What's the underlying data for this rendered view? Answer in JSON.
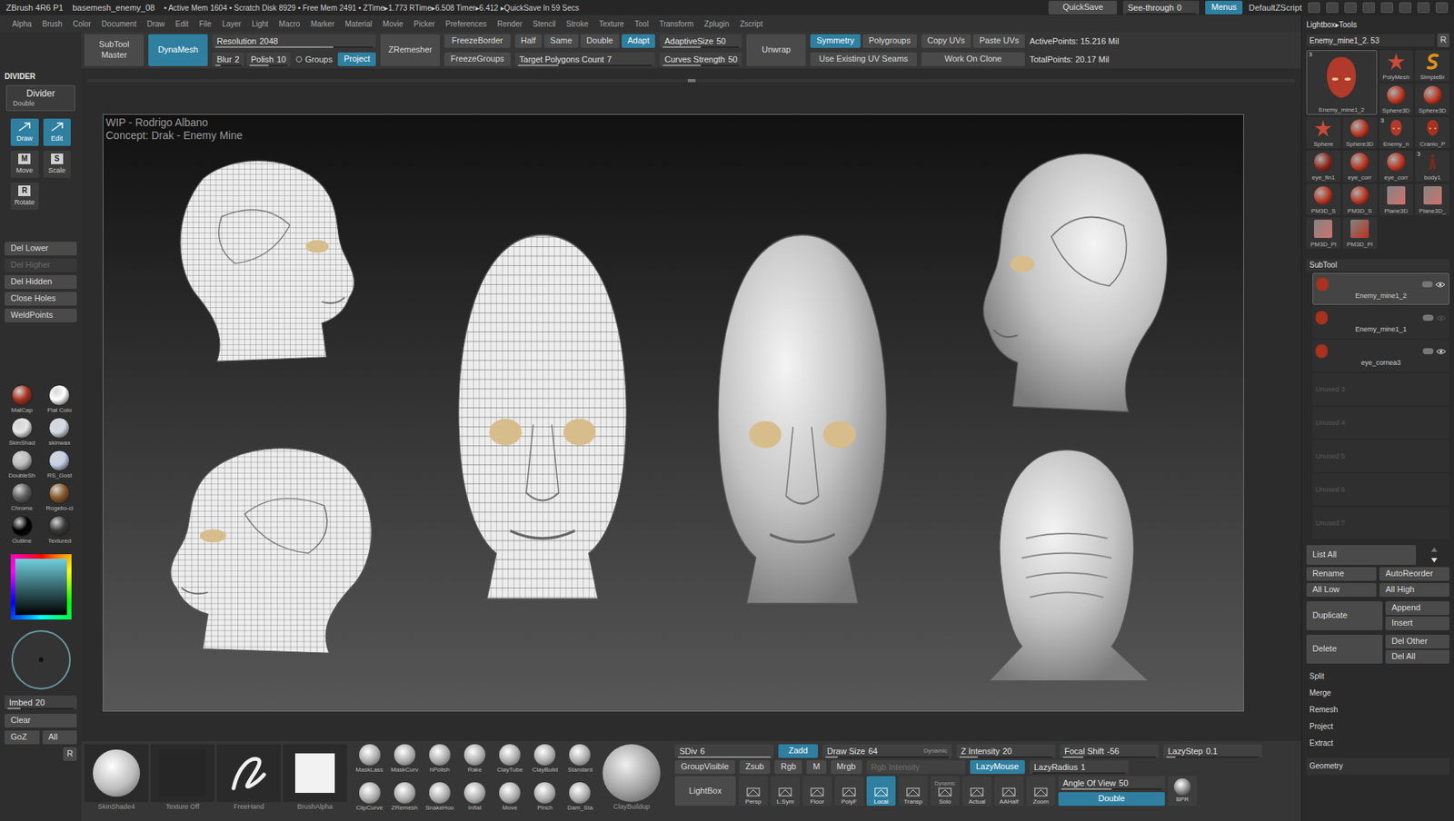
{
  "title_bar": {
    "app": "ZBrush 4R6 P1",
    "file": "basemesh_enemy_08",
    "stats": "• Active Mem 1604 • Scratch Disk 8929 • Free Mem 2491 • ZTime▸1.773 RTime▸6.508 Timer▸6.412 ▸QuickSave In 59 Secs",
    "quicksave": "QuickSave",
    "see_through": {
      "label": "See-through",
      "value": "0",
      "level": 0
    },
    "menus": {
      "label": "Menus",
      "selected": true
    },
    "script": "DefaultZScript"
  },
  "menu": [
    "Alpha",
    "Brush",
    "Color",
    "Document",
    "Draw",
    "Edit",
    "File",
    "Layer",
    "Light",
    "Macro",
    "Marker",
    "Material",
    "Movie",
    "Picker",
    "Preferences",
    "Render",
    "Stencil",
    "Stroke",
    "Texture",
    "Tool",
    "Transform",
    "Zplugin",
    "Zscript"
  ],
  "top_shelf": [
    {
      "kind": "big",
      "label": "SubTool Master",
      "active": false
    },
    {
      "kind": "big",
      "label": "DynaMesh",
      "active": true
    },
    {
      "kind": "stack",
      "rows": [
        [
          {
            "kind": "slider",
            "label": "Resolution",
            "value": "2048",
            "level": 0.75
          }
        ],
        [
          {
            "kind": "slider",
            "label": "Blur",
            "value": "2",
            "level": 0.2
          },
          {
            "kind": "slider",
            "label": "Polish",
            "value": "10",
            "level": 0.5
          },
          {
            "kind": "toggle",
            "label": "Groups",
            "active": false
          },
          {
            "kind": "button",
            "label": "Project",
            "active": true
          }
        ]
      ]
    },
    {
      "kind": "big",
      "label": "ZRemesher",
      "active": false
    },
    {
      "kind": "stack",
      "rows": [
        [
          {
            "kind": "button",
            "label": "FreezeBorder",
            "active": false
          }
        ],
        [
          {
            "kind": "button",
            "label": "FreezeGroups",
            "active": false
          }
        ]
      ]
    },
    {
      "kind": "stack",
      "rows": [
        [
          {
            "kind": "button",
            "label": "Half",
            "active": false
          },
          {
            "kind": "button",
            "label": "Same",
            "active": false
          },
          {
            "kind": "button",
            "label": "Double",
            "active": false
          },
          {
            "kind": "button",
            "label": "Adapt",
            "active": true
          }
        ],
        [
          {
            "kind": "slider",
            "label": "Target Polygons Count",
            "value": "7",
            "level": 0.3
          }
        ]
      ]
    },
    {
      "kind": "stack",
      "rows": [
        [
          {
            "kind": "slider",
            "label": "AdaptiveSize",
            "value": "50",
            "level": 0.5
          }
        ],
        [
          {
            "kind": "slider",
            "label": "Curves Strength",
            "value": "50",
            "level": 0.5
          }
        ]
      ]
    },
    {
      "kind": "big",
      "label": "Unwrap",
      "active": false
    },
    {
      "kind": "stack",
      "rows": [
        [
          {
            "kind": "button",
            "label": "Symmetry",
            "active": true
          },
          {
            "kind": "button",
            "label": "Polygroups",
            "active": false
          }
        ],
        [
          {
            "kind": "button",
            "label": "Use Existing UV Seams",
            "active": false
          }
        ]
      ]
    },
    {
      "kind": "stack",
      "rows": [
        [
          {
            "kind": "button",
            "label": "Copy UVs",
            "active": false
          },
          {
            "kind": "button",
            "label": "Paste UVs",
            "active": false
          }
        ],
        [
          {
            "kind": "button",
            "label": "Work On Clone",
            "active": false
          }
        ]
      ]
    },
    {
      "kind": "stack",
      "rows": [
        [
          {
            "kind": "stat",
            "label": "ActivePoints: 15.216 Mil"
          }
        ],
        [
          {
            "kind": "stat",
            "label": "TotalPoints: 20.17 Mil"
          }
        ]
      ]
    }
  ],
  "left_shelf": {
    "header": "DIVIDER",
    "divider": {
      "label": "Divider",
      "sub": "Double"
    },
    "tools": [
      {
        "label": "Draw",
        "glyph": "",
        "selected": true
      },
      {
        "label": "Edit",
        "glyph": "",
        "selected": true
      },
      {
        "label": "Move",
        "glyph": "M",
        "selected": false
      },
      {
        "label": "Scale",
        "glyph": "S",
        "selected": false
      },
      {
        "label": "Rotate",
        "glyph": "R",
        "selected": false
      }
    ],
    "actions": [
      {
        "label": "Del Lower",
        "disabled": false
      },
      {
        "label": "Del Higher",
        "disabled": true
      },
      {
        "label": "Del Hidden",
        "disabled": false
      },
      {
        "label": "Close Holes",
        "disabled": false
      },
      {
        "label": "WeldPoints",
        "disabled": false
      }
    ],
    "materials": [
      {
        "label": "MatCap",
        "color": "#a8321f"
      },
      {
        "label": "Flat Colo",
        "color": "#ffffff"
      },
      {
        "label": "SkinShad",
        "color": "#e6e6e6"
      },
      {
        "label": "skinwax",
        "color": "#d4dce6"
      },
      {
        "label": "DoubleSh",
        "color": "#bdbdbd"
      },
      {
        "label": "RS_Gost",
        "color": "#c6cfe6"
      },
      {
        "label": "Chrome",
        "color": "#5e5e5e"
      },
      {
        "label": "Rogelio-cl",
        "color": "#8a5a2a"
      },
      {
        "label": "Outline",
        "color": "#000000"
      },
      {
        "label": "Textured",
        "color": "#3a3a3a"
      }
    ],
    "imbed": {
      "label": "Imbed",
      "value": "20",
      "level": 0.2
    },
    "clear": "Clear",
    "goz": "GoZ",
    "all": "All",
    "r": "R"
  },
  "canvas": {
    "watermark": [
      "WIP - Rodrigo Albano",
      "Concept: Drak - Enemy Mine"
    ],
    "heads": [
      {
        "view": "side-right",
        "shading": "wireframe"
      },
      {
        "view": "side-left",
        "shading": "wireframe"
      },
      {
        "view": "front",
        "shading": "wireframe"
      },
      {
        "view": "front",
        "shading": "smooth"
      },
      {
        "view": "side-left",
        "shading": "smooth"
      },
      {
        "view": "back",
        "shading": "smooth"
      }
    ]
  },
  "bottom_shelf": {
    "tiles": [
      {
        "label": "SkinShade4",
        "kind": "sphere"
      },
      {
        "label": "Texture Off",
        "kind": "empty"
      },
      {
        "label": "FreeHand",
        "kind": "stroke"
      },
      {
        "label": "BrushAlpha",
        "kind": "square"
      }
    ],
    "brushes": [
      "MaskLass",
      "MaskCurv",
      "hPolish",
      "Rake",
      "ClayTube",
      "ClayBuild",
      "Standard",
      "ClipCurve",
      "ZRemesh",
      "SnakeHoo",
      "Inflat",
      "Move",
      "Pinch",
      "Dam_Sta"
    ],
    "current_brush": "ClayBuildup",
    "row1": [
      {
        "kind": "slider",
        "label": "SDiv",
        "value": "6",
        "level": 1
      },
      {
        "kind": "button",
        "label": "Zadd",
        "active": true
      },
      {
        "kind": "slider",
        "label": "Draw Size",
        "value": "64",
        "level": 0.1,
        "tag": "Dynamic"
      },
      {
        "kind": "slider",
        "label": "Z Intensity",
        "value": "20",
        "level": 0.2
      },
      {
        "kind": "slider",
        "label": "Focal Shift",
        "value": "-56",
        "level": 0.22
      },
      {
        "kind": "slider",
        "label": "LazyStep",
        "value": "0.1",
        "level": 0.1
      }
    ],
    "row2": [
      {
        "kind": "button",
        "label": "GroupVisible",
        "active": false
      },
      {
        "kind": "button",
        "label": "Zsub",
        "active": false
      },
      {
        "kind": "button",
        "label": "Rgb",
        "active": false
      },
      {
        "kind": "button",
        "label": "M",
        "active": false
      },
      {
        "kind": "button",
        "label": "Mrgb",
        "active": false
      },
      {
        "kind": "slider",
        "label": "Rgb Intensity",
        "disabled": true
      },
      {
        "kind": "button",
        "label": "LazyMouse",
        "active": true
      },
      {
        "kind": "slider",
        "label": "LazyRadius",
        "value": "1",
        "level": 0
      }
    ],
    "lightbox": "LightBox",
    "icons": [
      {
        "label": "Persp",
        "active": false
      },
      {
        "label": "L.Sym",
        "active": false
      },
      {
        "label": "Floor",
        "active": false
      },
      {
        "label": "PolyF",
        "active": false
      },
      {
        "label": "Local",
        "active": true
      },
      {
        "label": "Transp",
        "active": false
      },
      {
        "label": "Solo",
        "active": false,
        "tag": "Dynamic"
      },
      {
        "label": "Actual",
        "active": false
      },
      {
        "label": "AAHalf",
        "active": false
      },
      {
        "label": "Zoom",
        "active": false
      }
    ],
    "angle": {
      "label": "Angle Of View",
      "value": "50",
      "level": 0.5
    },
    "double": {
      "label": "Double",
      "active": true
    },
    "bpr": "BPR"
  },
  "right_tray": {
    "header": "Lightbox▸Tools",
    "tool_name": "Enemy_mine1_2. 53",
    "r": "R",
    "tools": [
      {
        "label": "Enemy_mine1_2",
        "kind": "head",
        "color": "#b23a2a",
        "count": "3"
      },
      {
        "label": "PolyMesh",
        "kind": "star",
        "color": "#c84a38",
        "count": ""
      },
      {
        "label": "SimpleBr",
        "kind": "brush",
        "color": "#e0901e",
        "count": ""
      },
      {
        "label": "Sphere3D",
        "kind": "sphere",
        "color": "#b8321e",
        "count": ""
      },
      {
        "label": "Sphere3D",
        "kind": "sphere",
        "color": "#b8321e",
        "count": ""
      },
      {
        "label": "Sphere",
        "kind": "star",
        "color": "#c84a38",
        "count": ""
      },
      {
        "label": "Sphere3D",
        "kind": "sphere",
        "color": "#b8321e",
        "count": ""
      },
      {
        "label": "Enemy_n",
        "kind": "head",
        "color": "#b23a2a",
        "count": "3"
      },
      {
        "label": "Cranio_P",
        "kind": "head",
        "color": "#a8321f",
        "count": ""
      },
      {
        "label": "eye_fin1",
        "kind": "sphere",
        "color": "#8c2418",
        "count": ""
      },
      {
        "label": "eye_corr",
        "kind": "sphere",
        "color": "#b8321e",
        "count": ""
      },
      {
        "label": "eye_corr",
        "kind": "sphere",
        "color": "#b8321e",
        "count": ""
      },
      {
        "label": "body1",
        "kind": "figure",
        "color": "#7a2a20",
        "count": "3"
      },
      {
        "label": "PM3D_S",
        "kind": "sphere",
        "color": "#b8321e",
        "count": ""
      },
      {
        "label": "PM3D_S",
        "kind": "sphere",
        "color": "#b8321e",
        "count": ""
      },
      {
        "label": "Plane3D",
        "kind": "plane",
        "color": "#d0706a",
        "count": ""
      },
      {
        "label": "Plane3D_",
        "kind": "plane",
        "color": "#d0706a",
        "count": ""
      },
      {
        "label": "PM3D_Pl",
        "kind": "plane",
        "color": "#d0706a",
        "count": ""
      },
      {
        "label": "PM3D_Pl",
        "kind": "plane",
        "color": "#b8321e",
        "count": ""
      }
    ],
    "subtool_header": "SubTool",
    "subtools": [
      {
        "label": "Enemy_mine1_2",
        "selected": true,
        "visible": true,
        "used": true
      },
      {
        "label": "Enemy_mine1_1",
        "selected": false,
        "visible": false,
        "used": true
      },
      {
        "label": "eye_cornea3",
        "selected": false,
        "visible": true,
        "used": true
      },
      {
        "label": "Unused 3",
        "selected": false,
        "visible": false,
        "used": false
      },
      {
        "label": "Unused 4",
        "selected": false,
        "visible": false,
        "used": false
      },
      {
        "label": "Unused 5",
        "selected": false,
        "visible": false,
        "used": false
      },
      {
        "label": "Unused 6",
        "selected": false,
        "visible": false,
        "used": false
      },
      {
        "label": "Unused 7",
        "selected": false,
        "visible": false,
        "used": false
      }
    ],
    "list_all": "List All",
    "pairs": [
      [
        "Rename",
        "AutoReorder"
      ],
      [
        "All Low",
        "All High"
      ]
    ],
    "groups": [
      {
        "main": "Duplicate",
        "sub": [
          "Append",
          "Insert"
        ]
      },
      {
        "main": "Delete",
        "sub": [
          "Del Other",
          "Del All"
        ]
      }
    ],
    "sections": [
      "Split",
      "Merge",
      "Remesh",
      "Project",
      "Extract",
      "Geometry"
    ]
  }
}
